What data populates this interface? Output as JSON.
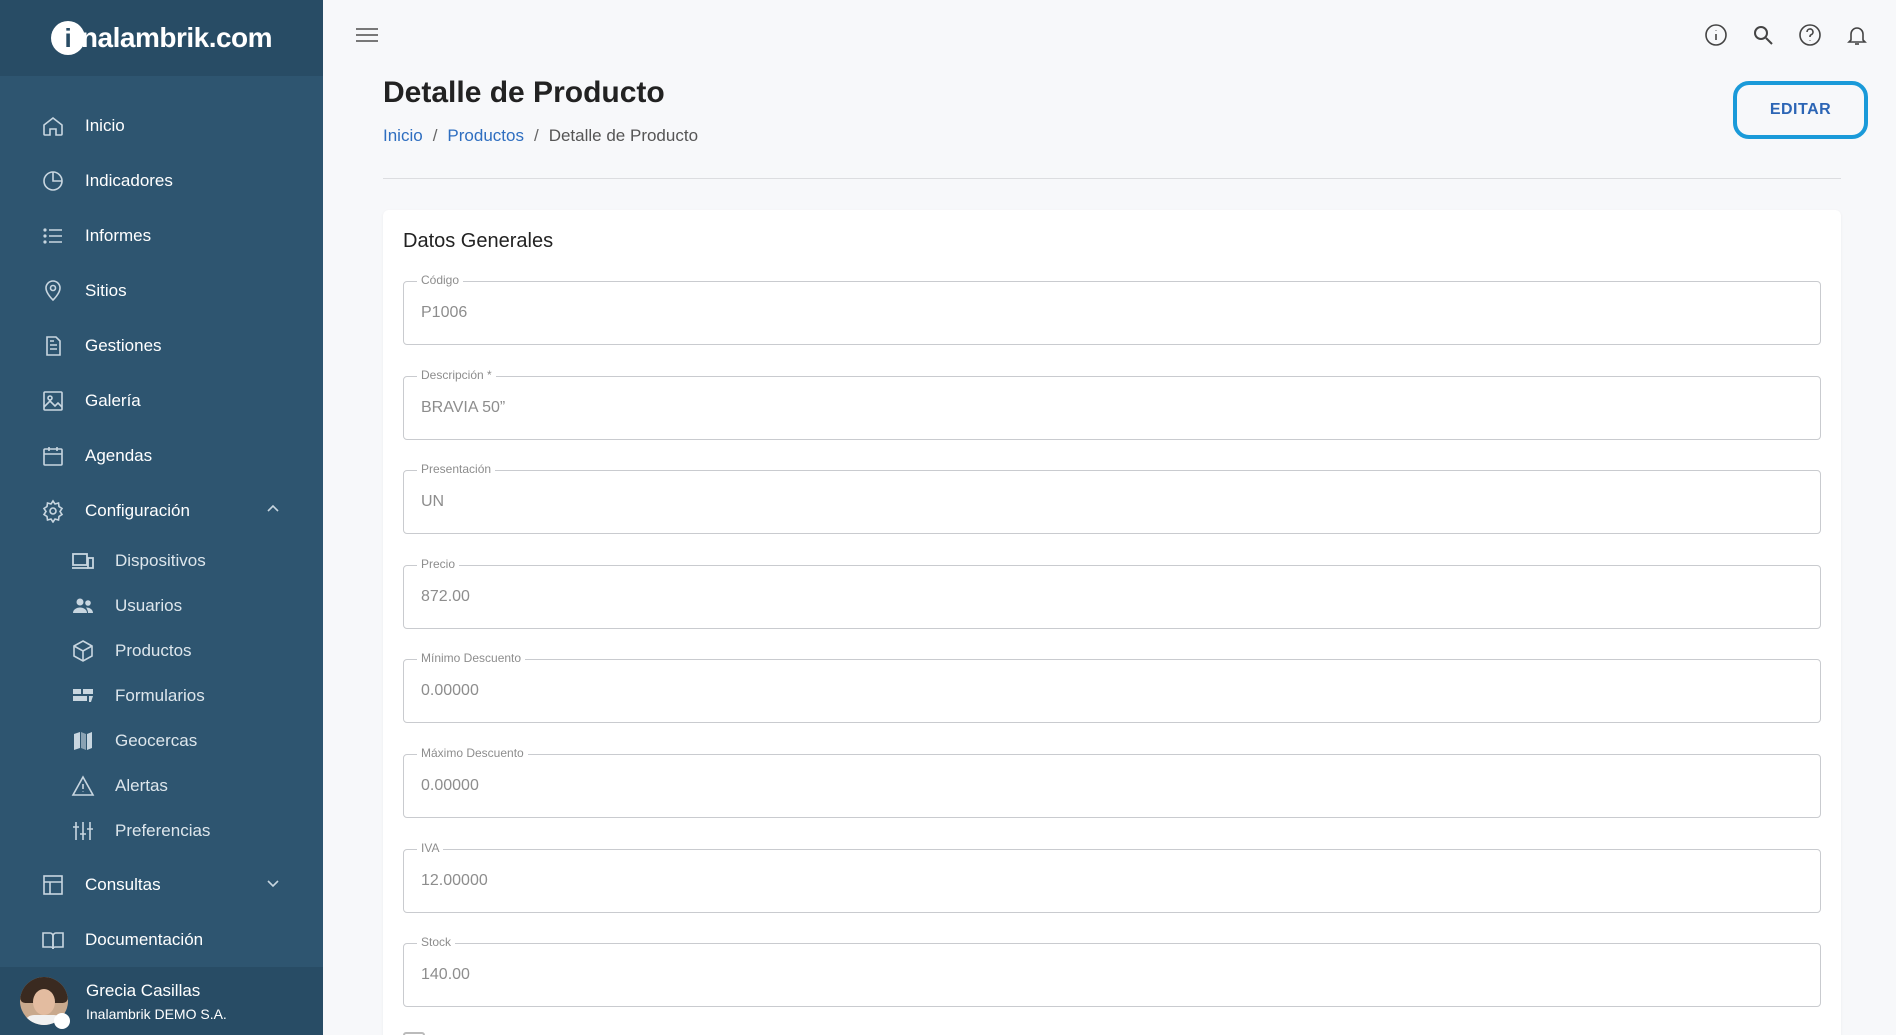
{
  "brand": {
    "logo_initial": "i",
    "logo_rest": "nalambrik.com"
  },
  "sidebar": {
    "items": [
      {
        "label": "Inicio",
        "icon": "home-icon"
      },
      {
        "label": "Indicadores",
        "icon": "pie-chart-icon"
      },
      {
        "label": "Informes",
        "icon": "list-icon"
      },
      {
        "label": "Sitios",
        "icon": "location-pin-icon"
      },
      {
        "label": "Gestiones",
        "icon": "document-icon"
      },
      {
        "label": "Galería",
        "icon": "image-icon"
      },
      {
        "label": "Agendas",
        "icon": "calendar-icon"
      },
      {
        "label": "Configuración",
        "icon": "gear-icon",
        "expanded": true
      }
    ],
    "sub_items": [
      {
        "label": "Dispositivos",
        "icon": "devices-icon"
      },
      {
        "label": "Usuarios",
        "icon": "users-icon"
      },
      {
        "label": "Productos",
        "icon": "box-icon"
      },
      {
        "label": "Formularios",
        "icon": "form-icon"
      },
      {
        "label": "Geocercas",
        "icon": "map-icon"
      },
      {
        "label": "Alertas",
        "icon": "warning-icon"
      },
      {
        "label": "Preferencias",
        "icon": "sliders-icon"
      }
    ],
    "bottom_items": [
      {
        "label": "Consultas",
        "icon": "table-icon",
        "expanded": false
      },
      {
        "label": "Documentación",
        "icon": "book-icon"
      }
    ]
  },
  "user": {
    "name": "Grecia Casillas",
    "company": "Inalambrik DEMO S.A."
  },
  "topbar": {
    "icons": [
      "info-icon",
      "search-icon",
      "help-icon",
      "bell-icon"
    ]
  },
  "page": {
    "title": "Detalle de Producto",
    "breadcrumb": [
      "Inicio",
      "Productos",
      "Detalle de Producto"
    ],
    "edit_label": "EDITAR"
  },
  "card": {
    "title": "Datos Generales",
    "fields": [
      {
        "label": "Código",
        "value": "P1006"
      },
      {
        "label": "Descripción *",
        "value": "BRAVIA 50”"
      },
      {
        "label": "Presentación",
        "value": "UN"
      },
      {
        "label": "Precio",
        "value": "872.00"
      },
      {
        "label": "Mínimo Descuento",
        "value": "0.00000"
      },
      {
        "label": "Máximo Descuento",
        "value": "0.00000"
      },
      {
        "label": "IVA",
        "value": "12.00000"
      },
      {
        "label": "Stock",
        "value": "140.00"
      }
    ]
  },
  "colors": {
    "sidebar": "#2e5570",
    "sidebar_dark": "#284c65",
    "link": "#2e6ec0",
    "edit_border": "#1a9ad9"
  }
}
